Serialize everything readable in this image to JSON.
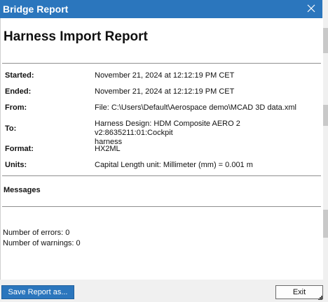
{
  "window": {
    "title": "Bridge Report"
  },
  "report": {
    "title": "Harness Import Report",
    "fields": {
      "started_label": "Started:",
      "started_value": "November 21, 2024 at 12:12:19 PM CET",
      "ended_label": "Ended:",
      "ended_value": "November 21, 2024 at 12:12:19 PM CET",
      "from_label": "From:",
      "from_value": "File: C:\\Users\\Default\\Aerospace demo\\MCAD 3D data.xml",
      "to_label": "To:",
      "to_value_line1": "Harness Design: HDM Composite AERO 2 v2:8635211:01:Cockpit",
      "to_value_line2": "harness",
      "format_label": "Format:",
      "format_value": "HX2ML",
      "units_label": "Units:",
      "units_value": "Capital Length unit: Millimeter (mm) = 0.001 m"
    },
    "messages_label": "Messages",
    "errors": "Number of errors: 0",
    "warnings": "Number of warnings: 0"
  },
  "footer": {
    "save_label": "Save Report as...",
    "exit_label": "Exit"
  },
  "colors": {
    "titlebar": "#2b76bd",
    "primary_button": "#2b76bd"
  }
}
